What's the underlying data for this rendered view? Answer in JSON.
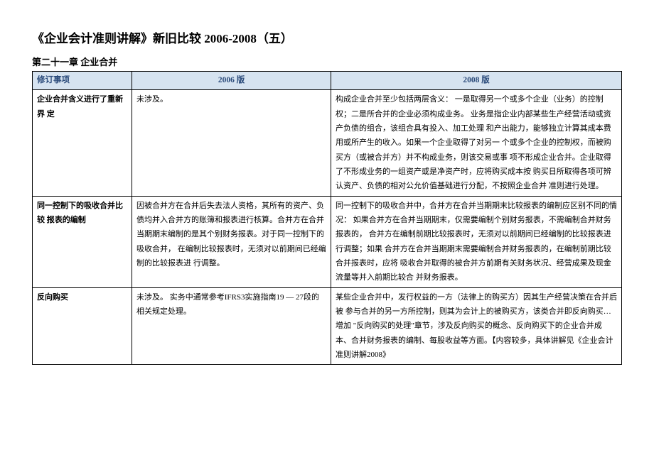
{
  "title": "《企业会计准则讲解》新旧比较 2006-2008（五）",
  "section": "第二十一章 企业合并",
  "table": {
    "headers": [
      "修订事项",
      "2006 版",
      "2008 版"
    ],
    "rows": [
      {
        "item": "企业合并含义进行了重新界 定",
        "v2006": "未涉及。",
        "v2008": "构成企业合并至少包括两层含义：\n一是取得另一个或多个企业（业务）的控制权；二是所合并的企业必须构成业务。 业务是指企业内部某些生产经营活动或资产负债的组合，该组合具有投入、加工处理 和产出能力，能够独立计算其成本费用或所产生的收入。如果一个企业取得了对另一 个或多个企业的控制权，而被购买方（或被合并方）并不构成业务，则该交易或事 项不形成企业合并。企业取得了不形成业务的一组资产或是净资产时，应将购买成本按 购买日所取得各项可辨认资产、负债的相对公允价值基础进行分配，不按照企业合并 准则进行处理。"
      },
      {
        "item": "同一控制下的吸收合并比较 报表的编制",
        "v2006": "因被合并方在合并后失去法人资格，其所有的资产、负债均并入合并方的账簿和报表进行核算。合并方在合并当期期末编制的是其个别财务报表。对于同一控制下的吸收合并， 在编制比较报表时，无须对以前期间已经编制的比较报表进 行调整。",
        "v2008": "同一控制下的吸收合并中，合并方在合并当期期末比较报表的编制应区别不同的情况： 如果合并方在合并当期期末，仅需要编制个别财务报表，不需编制合并财务报表的， 合并方在编制前期比较报表时，无须对以前期间已经编制的比较报表进行调整；如果 合并方在合并当期期末需要编制合并财务报表的，在编制前期比较合并报表时，应将 吸收合并取得的被合并方前期有关财务状况、经营成果及现金流量等并入前期比较合 并财务报表。"
      },
      {
        "item": "反向购买",
        "v2006": "未涉及。\n实务中通常参考IFRS3实施指南19 — 27段的相关规定处理。",
        "v2008": "某些企业合并中，发行权益的一方（法律上的购买方）因其生产经营决策在合并后被 参与合并的另一方所控制，则其为会计上的被购买方，该类合并即反向购买…增加 \"反向购买的处理\"章节，涉及反向购买的概念、反向购买下的企业合并成本、合并财务报表的编制、每股收益等方面。【内容较多，具体讲解见《企业会计准则讲解2008》"
      }
    ]
  }
}
